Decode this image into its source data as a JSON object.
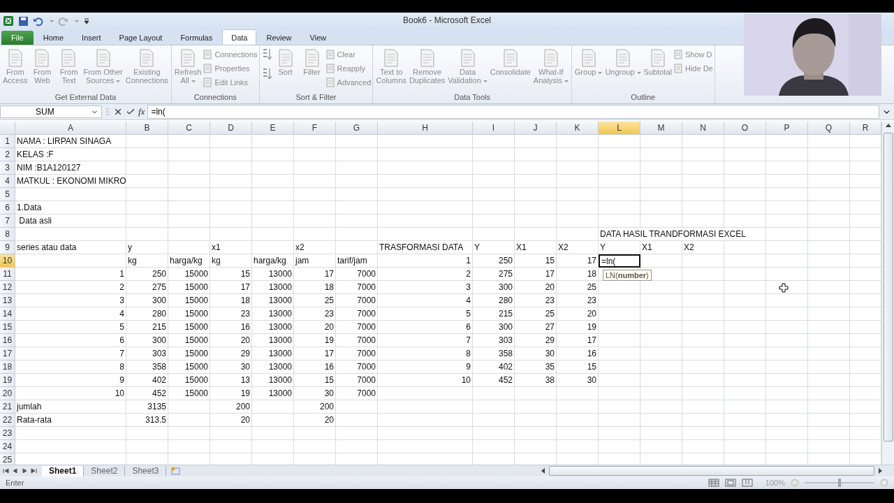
{
  "window": {
    "title": "Book6  -  Microsoft Excel"
  },
  "tabs": [
    {
      "label": "File",
      "kind": "file",
      "selected": false
    },
    {
      "label": "Home",
      "kind": "tab",
      "selected": false
    },
    {
      "label": "Insert",
      "kind": "tab",
      "selected": false
    },
    {
      "label": "Page Layout",
      "kind": "tab",
      "selected": false
    },
    {
      "label": "Formulas",
      "kind": "tab",
      "selected": false
    },
    {
      "label": "Data",
      "kind": "tab",
      "selected": true
    },
    {
      "label": "Review",
      "kind": "tab",
      "selected": false
    },
    {
      "label": "View",
      "kind": "tab",
      "selected": false
    }
  ],
  "ribbon": {
    "disabled": true,
    "groups": [
      {
        "label": "Get External Data",
        "items": [
          {
            "kind": "large",
            "lines": [
              "From",
              "Access"
            ]
          },
          {
            "kind": "large",
            "lines": [
              "From",
              "Web"
            ]
          },
          {
            "kind": "large",
            "lines": [
              "From",
              "Text"
            ]
          },
          {
            "kind": "large",
            "lines": [
              "From Other",
              "Sources"
            ],
            "menu": true
          },
          {
            "kind": "large",
            "lines": [
              "Existing",
              "Connections"
            ]
          }
        ]
      },
      {
        "label": "Connections",
        "items": [
          {
            "kind": "large",
            "lines": [
              "Refresh",
              "All"
            ],
            "menu": true
          },
          {
            "kind": "stack",
            "items": [
              "Connections",
              "Properties",
              "Edit Links"
            ]
          }
        ]
      },
      {
        "label": "Sort & Filter",
        "items": [
          {
            "kind": "sort_pair"
          },
          {
            "kind": "large",
            "lines": [
              "Sort"
            ]
          },
          {
            "kind": "large",
            "lines": [
              "Filter"
            ]
          },
          {
            "kind": "stack",
            "items": [
              "Clear",
              "Reapply",
              "Advanced"
            ]
          }
        ]
      },
      {
        "label": "Data Tools",
        "items": [
          {
            "kind": "large",
            "lines": [
              "Text to",
              "Columns"
            ]
          },
          {
            "kind": "large",
            "lines": [
              "Remove",
              "Duplicates"
            ]
          },
          {
            "kind": "large",
            "lines": [
              "Data",
              "Validation"
            ],
            "menu": true
          },
          {
            "kind": "large",
            "lines": [
              "Consolidate"
            ]
          },
          {
            "kind": "large",
            "lines": [
              "What-If",
              "Analysis"
            ],
            "menu": true
          }
        ]
      },
      {
        "label": "Outline",
        "items": [
          {
            "kind": "large",
            "lines": [
              "Group"
            ],
            "menu": true
          },
          {
            "kind": "large",
            "lines": [
              "Ungroup"
            ],
            "menu": true
          },
          {
            "kind": "large",
            "lines": [
              "Subtotal"
            ]
          },
          {
            "kind": "stack",
            "items": [
              "Show D",
              "Hide De"
            ]
          }
        ]
      }
    ]
  },
  "formula_bar": {
    "name_box": "SUM",
    "fx": "fx",
    "formula": "=ln("
  },
  "columns": [
    {
      "label": "A",
      "selected": false
    },
    {
      "label": "B",
      "selected": false
    },
    {
      "label": "C",
      "selected": false
    },
    {
      "label": "D",
      "selected": false
    },
    {
      "label": "E",
      "selected": false
    },
    {
      "label": "F",
      "selected": false
    },
    {
      "label": "G",
      "selected": false
    },
    {
      "label": "H",
      "selected": false
    },
    {
      "label": "I",
      "selected": false
    },
    {
      "label": "J",
      "selected": false
    },
    {
      "label": "K",
      "selected": false
    },
    {
      "label": "L",
      "selected": true
    },
    {
      "label": "M",
      "selected": false
    },
    {
      "label": "N",
      "selected": false
    },
    {
      "label": "O",
      "selected": false
    },
    {
      "label": "P",
      "selected": false
    },
    {
      "label": "Q",
      "selected": false
    },
    {
      "label": "R",
      "selected": false
    }
  ],
  "rows": [
    {
      "header": "1",
      "selected": false,
      "cells": [
        "NAMA : LIRPAN SINAGA",
        null,
        null,
        null,
        null,
        null,
        null,
        null,
        null,
        null,
        null,
        null,
        null,
        null,
        null,
        null,
        null,
        null
      ]
    },
    {
      "header": "2",
      "selected": false,
      "cells": [
        "KELAS :F",
        null,
        null,
        null,
        null,
        null,
        null,
        null,
        null,
        null,
        null,
        null,
        null,
        null,
        null,
        null,
        null,
        null
      ]
    },
    {
      "header": "3",
      "selected": false,
      "cells": [
        "NIM :B1A120127",
        null,
        null,
        null,
        null,
        null,
        null,
        null,
        null,
        null,
        null,
        null,
        null,
        null,
        null,
        null,
        null,
        null
      ]
    },
    {
      "header": "4",
      "selected": false,
      "cells": [
        "MATKUL : EKONOMI MIKRO",
        null,
        null,
        null,
        null,
        null,
        null,
        null,
        null,
        null,
        null,
        null,
        null,
        null,
        null,
        null,
        null,
        null
      ]
    },
    {
      "header": "5",
      "selected": false,
      "cells": [
        null,
        null,
        null,
        null,
        null,
        null,
        null,
        null,
        null,
        null,
        null,
        null,
        null,
        null,
        null,
        null,
        null,
        null
      ]
    },
    {
      "header": "6",
      "selected": false,
      "cells": [
        "1.Data",
        null,
        null,
        null,
        null,
        null,
        null,
        null,
        null,
        null,
        null,
        null,
        null,
        null,
        null,
        null,
        null,
        null
      ]
    },
    {
      "header": "7",
      "selected": false,
      "cells": [
        " Data asli",
        null,
        null,
        null,
        null,
        null,
        null,
        null,
        null,
        null,
        null,
        null,
        null,
        null,
        null,
        null,
        null,
        null
      ]
    },
    {
      "header": "8",
      "selected": false,
      "cells": [
        null,
        null,
        null,
        null,
        null,
        null,
        null,
        null,
        null,
        null,
        null,
        "DATA HASIL TRANDFORMASI EXCEL",
        null,
        null,
        null,
        null,
        null,
        null
      ]
    },
    {
      "header": "9",
      "selected": false,
      "cells": [
        "series atau data",
        "y",
        null,
        "x1",
        null,
        "x2",
        null,
        "TRASFORMASI DATA",
        "Y",
        "X1",
        "X2",
        "Y",
        "X1",
        "X2",
        null,
        null,
        null,
        null
      ]
    },
    {
      "header": "10",
      "selected": true,
      "cells": [
        null,
        "kg",
        "harga/kg",
        "kg",
        "harga/kg",
        "jam",
        "tarif/jam",
        {
          "text": "1",
          "right": true
        },
        {
          "text": "250",
          "right": true
        },
        {
          "text": "15",
          "right": true
        },
        {
          "text": "17",
          "right": true
        },
        {
          "text": "=ln(",
          "active": true,
          "tooltip": "LN(**number**)"
        },
        null,
        null,
        null,
        null,
        null,
        null
      ]
    },
    {
      "header": "11",
      "selected": false,
      "cells": [
        {
          "text": "1",
          "right": true
        },
        {
          "text": "250",
          "right": true
        },
        {
          "text": "15000",
          "right": true
        },
        {
          "text": "15",
          "right": true
        },
        {
          "text": "13000",
          "right": true
        },
        {
          "text": "17",
          "right": true
        },
        {
          "text": "7000",
          "right": true
        },
        {
          "text": "2",
          "right": true
        },
        {
          "text": "275",
          "right": true
        },
        {
          "text": "17",
          "right": true
        },
        {
          "text": "18",
          "right": true
        },
        null,
        null,
        null,
        null,
        null,
        null,
        null
      ]
    },
    {
      "header": "12",
      "selected": false,
      "cells": [
        {
          "text": "2",
          "right": true
        },
        {
          "text": "275",
          "right": true
        },
        {
          "text": "15000",
          "right": true
        },
        {
          "text": "17",
          "right": true
        },
        {
          "text": "13000",
          "right": true
        },
        {
          "text": "18",
          "right": true
        },
        {
          "text": "7000",
          "right": true
        },
        {
          "text": "3",
          "right": true
        },
        {
          "text": "300",
          "right": true
        },
        {
          "text": "20",
          "right": true
        },
        {
          "text": "25",
          "right": true
        },
        null,
        null,
        null,
        null,
        null,
        null,
        null
      ]
    },
    {
      "header": "13",
      "selected": false,
      "cells": [
        {
          "text": "3",
          "right": true
        },
        {
          "text": "300",
          "right": true
        },
        {
          "text": "15000",
          "right": true
        },
        {
          "text": "18",
          "right": true
        },
        {
          "text": "13000",
          "right": true
        },
        {
          "text": "25",
          "right": true
        },
        {
          "text": "7000",
          "right": true
        },
        {
          "text": "4",
          "right": true
        },
        {
          "text": "280",
          "right": true
        },
        {
          "text": "23",
          "right": true
        },
        {
          "text": "23",
          "right": true
        },
        null,
        null,
        null,
        null,
        null,
        null,
        null
      ]
    },
    {
      "header": "14",
      "selected": false,
      "cells": [
        {
          "text": "4",
          "right": true
        },
        {
          "text": "280",
          "right": true
        },
        {
          "text": "15000",
          "right": true
        },
        {
          "text": "23",
          "right": true
        },
        {
          "text": "13000",
          "right": true
        },
        {
          "text": "23",
          "right": true
        },
        {
          "text": "7000",
          "right": true
        },
        {
          "text": "5",
          "right": true
        },
        {
          "text": "215",
          "right": true
        },
        {
          "text": "25",
          "right": true
        },
        {
          "text": "20",
          "right": true
        },
        null,
        null,
        null,
        null,
        null,
        null,
        null
      ]
    },
    {
      "header": "15",
      "selected": false,
      "cells": [
        {
          "text": "5",
          "right": true
        },
        {
          "text": "215",
          "right": true
        },
        {
          "text": "15000",
          "right": true
        },
        {
          "text": "16",
          "right": true
        },
        {
          "text": "13000",
          "right": true
        },
        {
          "text": "20",
          "right": true
        },
        {
          "text": "7000",
          "right": true
        },
        {
          "text": "6",
          "right": true
        },
        {
          "text": "300",
          "right": true
        },
        {
          "text": "27",
          "right": true
        },
        {
          "text": "19",
          "right": true
        },
        null,
        null,
        null,
        null,
        null,
        null,
        null
      ]
    },
    {
      "header": "16",
      "selected": false,
      "cells": [
        {
          "text": "6",
          "right": true
        },
        {
          "text": "300",
          "right": true
        },
        {
          "text": "15000",
          "right": true
        },
        {
          "text": "20",
          "right": true
        },
        {
          "text": "13000",
          "right": true
        },
        {
          "text": "19",
          "right": true
        },
        {
          "text": "7000",
          "right": true
        },
        {
          "text": "7",
          "right": true
        },
        {
          "text": "303",
          "right": true
        },
        {
          "text": "29",
          "right": true
        },
        {
          "text": "17",
          "right": true
        },
        null,
        null,
        null,
        null,
        null,
        null,
        null
      ]
    },
    {
      "header": "17",
      "selected": false,
      "cells": [
        {
          "text": "7",
          "right": true
        },
        {
          "text": "303",
          "right": true
        },
        {
          "text": "15000",
          "right": true
        },
        {
          "text": "29",
          "right": true
        },
        {
          "text": "13000",
          "right": true
        },
        {
          "text": "17",
          "right": true
        },
        {
          "text": "7000",
          "right": true
        },
        {
          "text": "8",
          "right": true
        },
        {
          "text": "358",
          "right": true
        },
        {
          "text": "30",
          "right": true
        },
        {
          "text": "16",
          "right": true
        },
        null,
        null,
        null,
        null,
        null,
        null,
        null
      ]
    },
    {
      "header": "18",
      "selected": false,
      "cells": [
        {
          "text": "8",
          "right": true
        },
        {
          "text": "358",
          "right": true
        },
        {
          "text": "15000",
          "right": true
        },
        {
          "text": "30",
          "right": true
        },
        {
          "text": "13000",
          "right": true
        },
        {
          "text": "16",
          "right": true
        },
        {
          "text": "7000",
          "right": true
        },
        {
          "text": "9",
          "right": true
        },
        {
          "text": "402",
          "right": true
        },
        {
          "text": "35",
          "right": true
        },
        {
          "text": "15",
          "right": true
        },
        null,
        null,
        null,
        null,
        null,
        null,
        null
      ]
    },
    {
      "header": "19",
      "selected": false,
      "cells": [
        {
          "text": "9",
          "right": true
        },
        {
          "text": "402",
          "right": true
        },
        {
          "text": "15000",
          "right": true
        },
        {
          "text": "13",
          "right": true
        },
        {
          "text": "13000",
          "right": true
        },
        {
          "text": "15",
          "right": true
        },
        {
          "text": "7000",
          "right": true
        },
        {
          "text": "10",
          "right": true
        },
        {
          "text": "452",
          "right": true
        },
        {
          "text": "38",
          "right": true
        },
        {
          "text": "30",
          "right": true
        },
        null,
        null,
        null,
        null,
        null,
        null,
        null
      ]
    },
    {
      "header": "20",
      "selected": false,
      "cells": [
        {
          "text": "10",
          "right": true
        },
        {
          "text": "452",
          "right": true
        },
        {
          "text": "15000",
          "right": true
        },
        {
          "text": "19",
          "right": true
        },
        {
          "text": "13000",
          "right": true
        },
        {
          "text": "30",
          "right": true
        },
        {
          "text": "7000",
          "right": true
        },
        null,
        null,
        null,
        null,
        null,
        null,
        null,
        null,
        null,
        null,
        null
      ]
    },
    {
      "header": "21",
      "selected": false,
      "cells": [
        "jumlah",
        {
          "text": "3135",
          "right": true
        },
        null,
        {
          "text": "200",
          "right": true
        },
        null,
        {
          "text": "200",
          "right": true
        },
        null,
        null,
        null,
        null,
        null,
        null,
        null,
        null,
        null,
        null,
        null,
        null
      ]
    },
    {
      "header": "22",
      "selected": false,
      "cells": [
        "Rata-rata",
        {
          "text": "313.5",
          "right": true
        },
        null,
        {
          "text": "20",
          "right": true
        },
        null,
        {
          "text": "20",
          "right": true
        },
        null,
        null,
        null,
        null,
        null,
        null,
        null,
        null,
        null,
        null,
        null,
        null
      ]
    },
    {
      "header": "23",
      "selected": false,
      "cells": [
        null,
        null,
        null,
        null,
        null,
        null,
        null,
        null,
        null,
        null,
        null,
        null,
        null,
        null,
        null,
        null,
        null,
        null
      ]
    },
    {
      "header": "24",
      "selected": false,
      "cells": [
        null,
        null,
        null,
        null,
        null,
        null,
        null,
        null,
        null,
        null,
        null,
        null,
        null,
        null,
        null,
        null,
        null,
        null
      ]
    },
    {
      "header": "25",
      "selected": false,
      "cells": [
        null,
        null,
        null,
        null,
        null,
        null,
        null,
        null,
        null,
        null,
        null,
        null,
        null,
        null,
        null,
        null,
        null,
        null
      ]
    }
  ],
  "sheet_tabs": [
    {
      "label": "Sheet1",
      "selected": true
    },
    {
      "label": "Sheet2",
      "selected": false
    },
    {
      "label": "Sheet3",
      "selected": false
    }
  ],
  "status_bar": {
    "mode": "Enter",
    "zoom": "100%",
    "zoom_slider": {
      "level": 0.5
    }
  }
}
